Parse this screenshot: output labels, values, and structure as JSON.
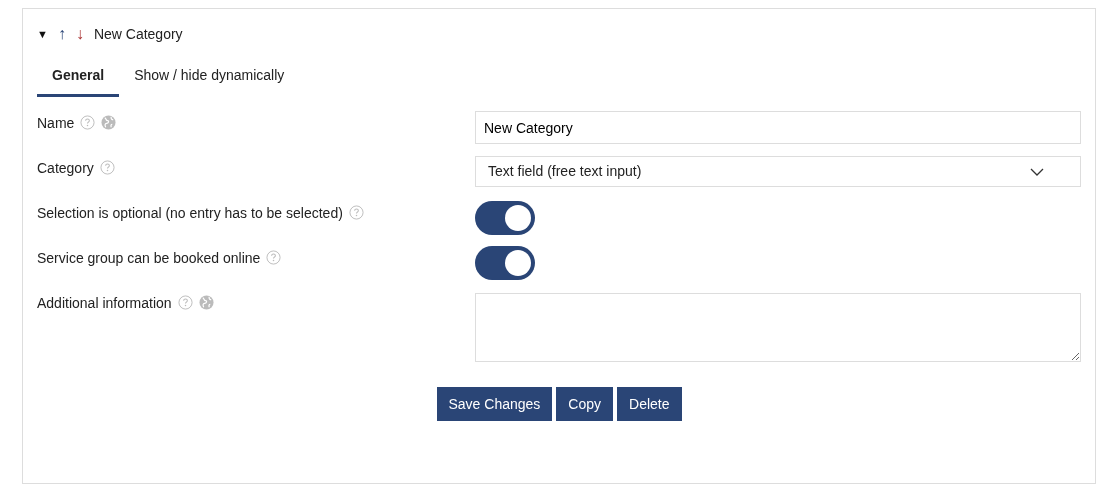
{
  "header": {
    "toggle": "▼",
    "move_up": "↑",
    "move_down": "↓",
    "title": "New Category",
    "expanded": true
  },
  "tabs": [
    {
      "label": "General",
      "selected": true
    },
    {
      "label": "Show / hide dynamically",
      "selected": false
    }
  ],
  "fields": [
    {
      "kind": "text",
      "label": "Name",
      "help": true,
      "translatable": true,
      "value": "New Category"
    },
    {
      "kind": "select",
      "label": "Category",
      "help": true,
      "translatable": false,
      "value": "Text field (free text input)"
    },
    {
      "kind": "toggle",
      "label": "Selection is optional (no entry has to be selected)",
      "help": true,
      "translatable": false,
      "on": true
    },
    {
      "kind": "toggle",
      "label": "Service group can be booked online",
      "help": true,
      "translatable": false,
      "on": true
    },
    {
      "kind": "textarea",
      "label": "Additional information",
      "help": true,
      "translatable": true
    }
  ],
  "buttons": [
    "Save Changes",
    "Copy",
    "Delete"
  ]
}
